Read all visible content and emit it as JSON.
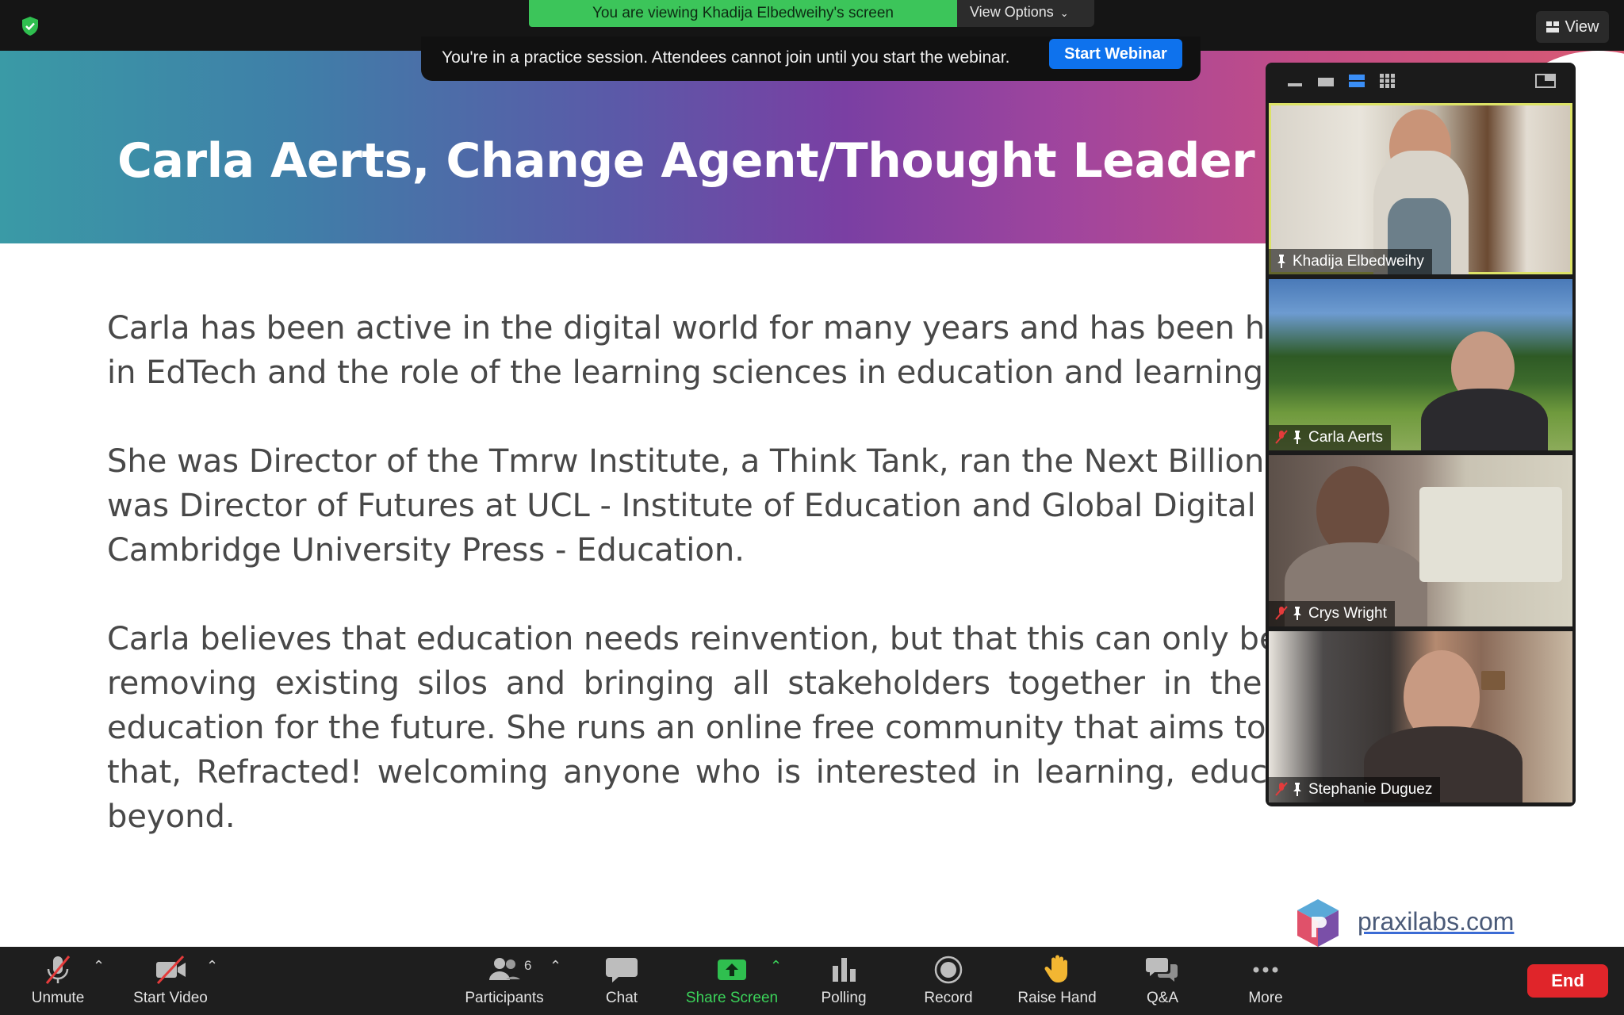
{
  "top_bar": {
    "viewing_banner": "You are viewing Khadija Elbedweihy's screen",
    "view_options_label": "View Options",
    "view_button_label": "View"
  },
  "practice_banner": {
    "message": "You're in a practice session. Attendees cannot join until you start the webinar.",
    "start_button": "Start Webinar"
  },
  "slide": {
    "title": "Carla Aerts, Change Agent/Thought Leader",
    "paragraphs": [
      [
        "Carla has been active in the digital world for many years and has been heavi",
        "in EdTech and the role of the learning sciences in education and learning."
      ],
      [
        "She was Director of the Tmrw Institute, a Think Tank, ran the Next Billion Ed",
        "was Director of Futures at UCL - Institute of Education and Global Digital D",
        "Cambridge University Press - Education."
      ],
      [
        "Carla believes that education needs reinvention, but that this can only be ac",
        "removing existing silos and bringing all stakeholders together in the",
        "education for the future. She runs an online free community that aims to",
        "that, Refracted! welcoming anyone who is interested in learning, educ",
        "beyond."
      ]
    ],
    "logo_text": "praxilabs.com"
  },
  "participants_video": [
    {
      "name": "Khadija Elbedweihy",
      "muted": false,
      "active_speaker": true
    },
    {
      "name": "Carla Aerts",
      "muted": true,
      "active_speaker": false
    },
    {
      "name": "Crys Wright",
      "muted": true,
      "active_speaker": false
    },
    {
      "name": "Stephanie Duguez",
      "muted": true,
      "active_speaker": false
    }
  ],
  "toolbar": {
    "unmute": "Unmute",
    "start_video": "Start Video",
    "participants": "Participants",
    "participants_count": "6",
    "chat": "Chat",
    "share_screen": "Share Screen",
    "polling": "Polling",
    "record": "Record",
    "raise_hand": "Raise Hand",
    "qa": "Q&A",
    "more": "More",
    "end": "End"
  },
  "colors": {
    "share_green": "#3bd35a",
    "start_webinar_blue": "#0e72ed",
    "end_red": "#e0252a",
    "viewing_banner_green": "#3cc55a",
    "active_speaker_outline": "#dce267"
  }
}
